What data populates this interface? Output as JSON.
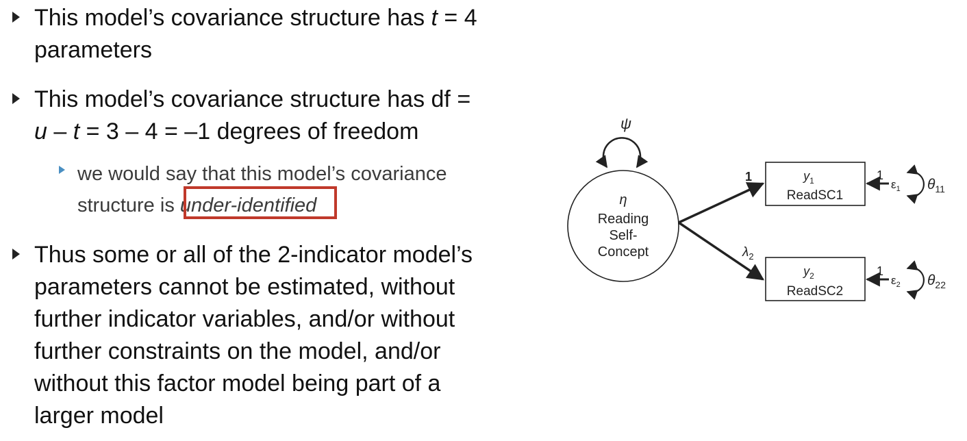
{
  "bullets": [
    {
      "lines": [
        {
          "pre": "This model’s covariance structure has ",
          "var": "t",
          "post": " = 4"
        },
        {
          "pre": "parameters"
        }
      ]
    },
    {
      "lines": [
        {
          "pre": "This model’s covariance structure has df ="
        },
        {
          "var": "u",
          "mid": " – ",
          "var2": "t",
          "post": " = 3 – 4 = –1 degrees of freedom"
        }
      ],
      "sub": {
        "line1": "we would say that this model’s covariance",
        "line2_pre": "structure is ",
        "line2_em": "under-identified"
      }
    },
    {
      "lines": [
        {
          "pre": "Thus some or all of the 2-indicator model’s"
        },
        {
          "pre": "parameters cannot be estimated, without"
        },
        {
          "pre": "further indicator variables, and/or without"
        },
        {
          "pre": "further constraints on the model, and/or"
        },
        {
          "pre": "without this factor model being part of a"
        },
        {
          "pre": "larger model"
        }
      ]
    }
  ],
  "diagram": {
    "psi": "ψ",
    "eta": "η",
    "latent_line1": "Reading",
    "latent_line2": "Self-",
    "latent_line3": "Concept",
    "loading1": "1",
    "loading2_sym": "λ",
    "loading2_sub": "2",
    "box1_var": "y",
    "box1_sub": "1",
    "box1_name": "ReadSC1",
    "box2_var": "y",
    "box2_sub": "2",
    "box2_name": "ReadSC2",
    "err1_path": "1",
    "err2_path": "1",
    "eps": "ε",
    "eps1_sub": "1",
    "eps2_sub": "2",
    "theta": "θ",
    "theta1_sub": "11",
    "theta2_sub": "22"
  },
  "colors": {
    "highlight_box": "#c0392b",
    "sub_bullet": "#4a8fc2"
  }
}
